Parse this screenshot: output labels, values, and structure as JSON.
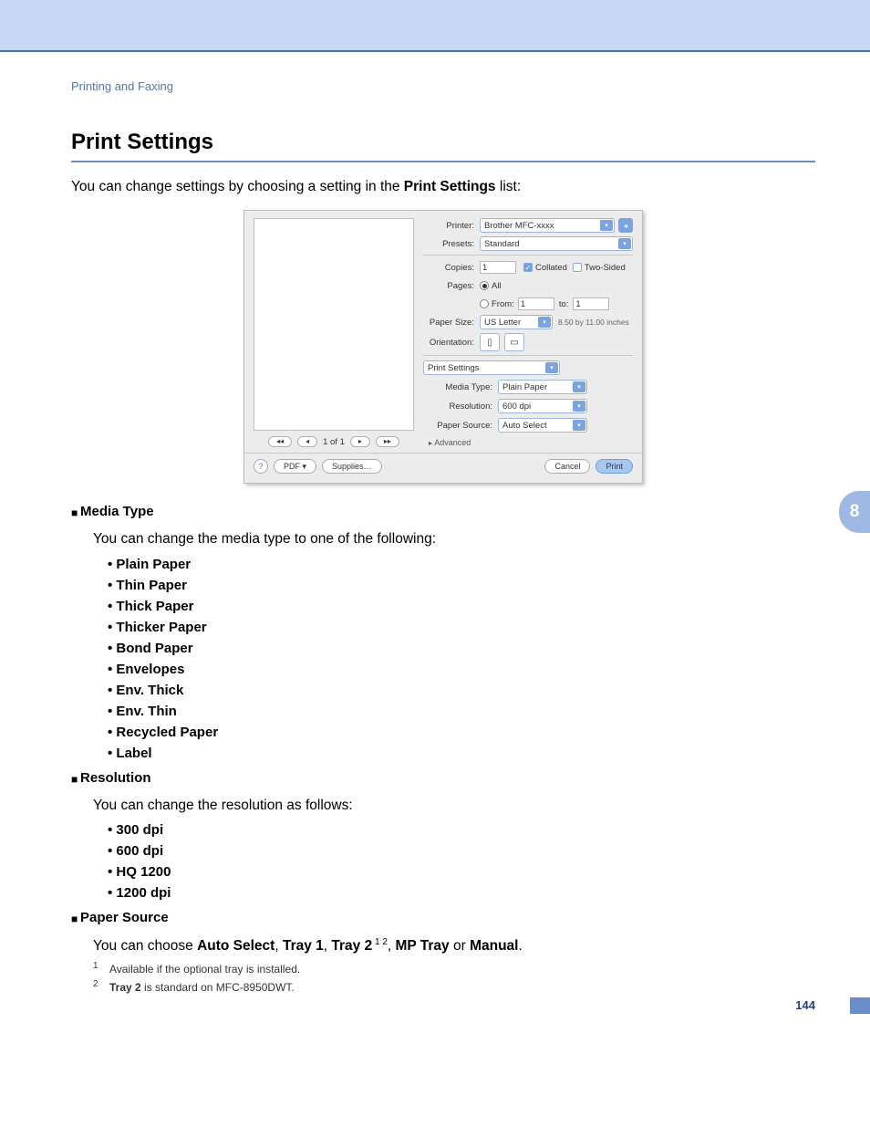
{
  "breadcrumb": "Printing and Faxing",
  "h1": "Print Settings",
  "intro_pre": "You can change settings by choosing a setting in the ",
  "intro_bold": "Print Settings",
  "intro_post": " list:",
  "dialog": {
    "printer_lab": "Printer:",
    "printer_val": "Brother MFC-xxxx",
    "presets_lab": "Presets:",
    "presets_val": "Standard",
    "copies_lab": "Copies:",
    "copies_val": "1",
    "collated": "Collated",
    "twosided": "Two-Sided",
    "pages_lab": "Pages:",
    "pages_all": "All",
    "pages_from": "From:",
    "from_val": "1",
    "pages_to": "to:",
    "to_val": "1",
    "papersize_lab": "Paper Size:",
    "papersize_val": "US Letter",
    "papersize_hint": "8.50 by 11.00 inches",
    "orient_lab": "Orientation:",
    "section_sel": "Print Settings",
    "mediatype_lab": "Media Type:",
    "mediatype_val": "Plain Paper",
    "resolution_lab": "Resolution:",
    "resolution_val": "600 dpi",
    "papersource_lab": "Paper Source:",
    "papersource_val": "Auto Select",
    "advanced": "Advanced",
    "pager": "1 of 1",
    "pdf_btn": "PDF ▾",
    "supplies_btn": "Supplies…",
    "cancel_btn": "Cancel",
    "print_btn": "Print"
  },
  "sec_media_title": "Media Type",
  "sec_media_body": "You can change the media type to one of the following:",
  "media_opts": [
    "Plain Paper",
    "Thin Paper",
    "Thick Paper",
    "Thicker Paper",
    "Bond Paper",
    "Envelopes",
    "Env. Thick",
    "Env. Thin",
    "Recycled Paper",
    "Label"
  ],
  "sec_res_title": "Resolution",
  "sec_res_body": "You can change the resolution as follows:",
  "res_opts": [
    "300 dpi",
    "600 dpi",
    "HQ 1200",
    "1200 dpi"
  ],
  "sec_src_title": "Paper Source",
  "src_line": {
    "pre": "You can choose ",
    "o1": "Auto Select",
    "o2": "Tray 1",
    "o3": "Tray 2",
    "o4": "MP Tray",
    "o5": "Manual",
    "or": " or ",
    "sep": ", ",
    "end": "."
  },
  "fn1": "Available if the optional tray is installed.",
  "fn2a": "Tray 2",
  "fn2b": " is standard on MFC-8950DWT.",
  "page_num": "144",
  "chapter_tab": "8"
}
